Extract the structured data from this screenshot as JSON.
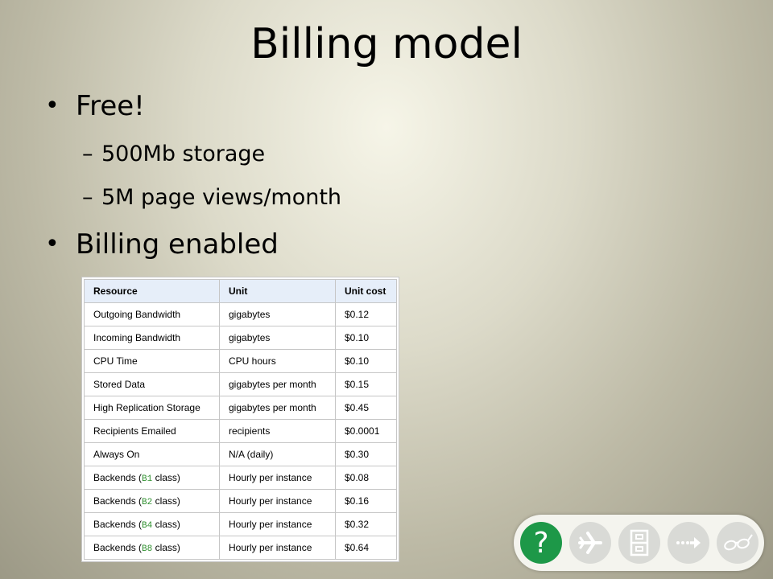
{
  "slide": {
    "title": "Billing model",
    "bullets": [
      {
        "text": "Free!",
        "sub": [
          "500Mb storage",
          "5M page views/month"
        ]
      },
      {
        "text": "Billing enabled"
      }
    ]
  },
  "table": {
    "headers": [
      "Resource",
      "Unit",
      "Unit cost"
    ],
    "rows": [
      {
        "resource": "Outgoing Bandwidth",
        "unit": "gigabytes",
        "cost": "$0.12"
      },
      {
        "resource": "Incoming Bandwidth",
        "unit": "gigabytes",
        "cost": "$0.10"
      },
      {
        "resource": "CPU Time",
        "unit": "CPU hours",
        "cost": "$0.10"
      },
      {
        "resource": "Stored Data",
        "unit": "gigabytes per month",
        "cost": "$0.15"
      },
      {
        "resource": "High Replication Storage",
        "unit": "gigabytes per month",
        "cost": "$0.45"
      },
      {
        "resource": "Recipients Emailed",
        "unit": "recipients",
        "cost": "$0.0001"
      },
      {
        "resource": "Always On",
        "unit": "N/A (daily)",
        "cost": "$0.30"
      },
      {
        "resource_prefix": "Backends (",
        "class": "B1",
        "resource_suffix": " class)",
        "unit": "Hourly per instance",
        "cost": "$0.08"
      },
      {
        "resource_prefix": "Backends (",
        "class": "B2",
        "resource_suffix": " class)",
        "unit": "Hourly per instance",
        "cost": "$0.16"
      },
      {
        "resource_prefix": "Backends (",
        "class": "B4",
        "resource_suffix": " class)",
        "unit": "Hourly per instance",
        "cost": "$0.32"
      },
      {
        "resource_prefix": "Backends (",
        "class": "B8",
        "resource_suffix": " class)",
        "unit": "Hourly per instance",
        "cost": "$0.64"
      }
    ]
  },
  "nav": {
    "help_label": "?",
    "icons": [
      "help-icon",
      "airplane-icon",
      "file-cabinet-icon",
      "arrow-right-icon",
      "glasses-icon"
    ]
  },
  "colors": {
    "header_bg": "#e6eef9",
    "class_code": "#2e8f2e",
    "help_button": "#1d9848",
    "nav_button": "#d9dad6"
  }
}
